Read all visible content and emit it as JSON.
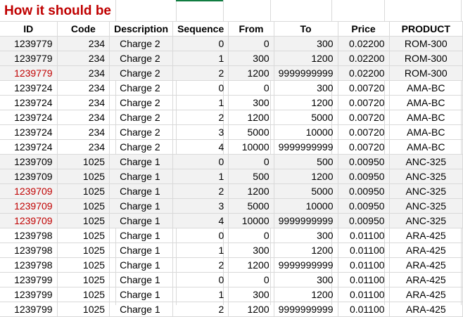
{
  "title": "How it should be",
  "headers": [
    "ID",
    "Code",
    "Description",
    "Sequence",
    "From",
    "To",
    "Price",
    "PRODUCT"
  ],
  "rows": [
    {
      "id": "1239779",
      "code": "234",
      "desc": "Charge 2",
      "seq": "0",
      "from": "0",
      "to": "300",
      "price": "0.02200",
      "product": "ROM-300",
      "shade": true,
      "red": false
    },
    {
      "id": "1239779",
      "code": "234",
      "desc": "Charge 2",
      "seq": "1",
      "from": "300",
      "to": "1200",
      "price": "0.02200",
      "product": "ROM-300",
      "shade": true,
      "red": false
    },
    {
      "id": "1239779",
      "code": "234",
      "desc": "Charge 2",
      "seq": "2",
      "from": "1200",
      "to": "9999999999",
      "price": "0.02200",
      "product": "ROM-300",
      "shade": true,
      "red": true
    },
    {
      "id": "1239724",
      "code": "234",
      "desc": "Charge 2",
      "seq": "0",
      "from": "0",
      "to": "300",
      "price": "0.00720",
      "product": "AMA-BC",
      "shade": false,
      "red": false
    },
    {
      "id": "1239724",
      "code": "234",
      "desc": "Charge 2",
      "seq": "1",
      "from": "300",
      "to": "1200",
      "price": "0.00720",
      "product": "AMA-BC",
      "shade": false,
      "red": false
    },
    {
      "id": "1239724",
      "code": "234",
      "desc": "Charge 2",
      "seq": "2",
      "from": "1200",
      "to": "5000",
      "price": "0.00720",
      "product": "AMA-BC",
      "shade": false,
      "red": false
    },
    {
      "id": "1239724",
      "code": "234",
      "desc": "Charge 2",
      "seq": "3",
      "from": "5000",
      "to": "10000",
      "price": "0.00720",
      "product": "AMA-BC",
      "shade": false,
      "red": false
    },
    {
      "id": "1239724",
      "code": "234",
      "desc": "Charge 2",
      "seq": "4",
      "from": "10000",
      "to": "9999999999",
      "price": "0.00720",
      "product": "AMA-BC",
      "shade": false,
      "red": false
    },
    {
      "id": "1239709",
      "code": "1025",
      "desc": "Charge 1",
      "seq": "0",
      "from": "0",
      "to": "500",
      "price": "0.00950",
      "product": "ANC-325",
      "shade": true,
      "red": false
    },
    {
      "id": "1239709",
      "code": "1025",
      "desc": "Charge 1",
      "seq": "1",
      "from": "500",
      "to": "1200",
      "price": "0.00950",
      "product": "ANC-325",
      "shade": true,
      "red": false
    },
    {
      "id": "1239709",
      "code": "1025",
      "desc": "Charge 1",
      "seq": "2",
      "from": "1200",
      "to": "5000",
      "price": "0.00950",
      "product": "ANC-325",
      "shade": true,
      "red": true
    },
    {
      "id": "1239709",
      "code": "1025",
      "desc": "Charge 1",
      "seq": "3",
      "from": "5000",
      "to": "10000",
      "price": "0.00950",
      "product": "ANC-325",
      "shade": true,
      "red": true
    },
    {
      "id": "1239709",
      "code": "1025",
      "desc": "Charge 1",
      "seq": "4",
      "from": "10000",
      "to": "9999999999",
      "price": "0.00950",
      "product": "ANC-325",
      "shade": true,
      "red": true
    },
    {
      "id": "1239798",
      "code": "1025",
      "desc": "Charge 1",
      "seq": "0",
      "from": "0",
      "to": "300",
      "price": "0.01100",
      "product": "ARA-425",
      "shade": false,
      "red": false
    },
    {
      "id": "1239798",
      "code": "1025",
      "desc": "Charge 1",
      "seq": "1",
      "from": "300",
      "to": "1200",
      "price": "0.01100",
      "product": "ARA-425",
      "shade": false,
      "red": false
    },
    {
      "id": "1239798",
      "code": "1025",
      "desc": "Charge 1",
      "seq": "2",
      "from": "1200",
      "to": "9999999999",
      "price": "0.01100",
      "product": "ARA-425",
      "shade": false,
      "red": false
    },
    {
      "id": "1239799",
      "code": "1025",
      "desc": "Charge 1",
      "seq": "0",
      "from": "0",
      "to": "300",
      "price": "0.01100",
      "product": "ARA-425",
      "shade": false,
      "red": false
    },
    {
      "id": "1239799",
      "code": "1025",
      "desc": "Charge 1",
      "seq": "1",
      "from": "300",
      "to": "1200",
      "price": "0.01100",
      "product": "ARA-425",
      "shade": false,
      "red": false
    },
    {
      "id": "1239799",
      "code": "1025",
      "desc": "Charge 1",
      "seq": "2",
      "from": "1200",
      "to": "9999999999",
      "price": "0.01100",
      "product": "ARA-425",
      "shade": false,
      "red": false
    }
  ],
  "colors": {
    "title": "#c00000",
    "id_highlight": "#c00000",
    "row_shade": "#f2f2f2",
    "gridline": "#d9d9d9",
    "selection": "#107c41"
  }
}
